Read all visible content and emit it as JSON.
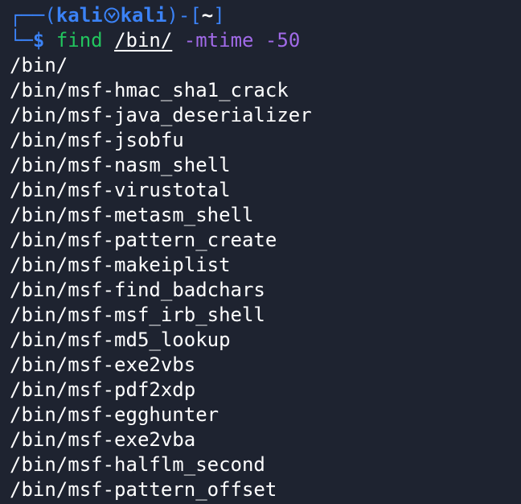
{
  "prompt": {
    "open_bracket": "┌──(",
    "user": "kali",
    "host": "kali",
    "close_mid": ")-[",
    "cwd": "~",
    "close_bracket": "]",
    "lower_bracket": "└─",
    "dollar": "$",
    "command": "find",
    "argument": "/bin/",
    "option": "-mtime",
    "value": "-50"
  },
  "output_lines": [
    "/bin/",
    "/bin/msf-hmac_sha1_crack",
    "/bin/msf-java_deserializer",
    "/bin/msf-jsobfu",
    "/bin/msf-nasm_shell",
    "/bin/msf-virustotal",
    "/bin/msf-metasm_shell",
    "/bin/msf-pattern_create",
    "/bin/msf-makeiplist",
    "/bin/msf-find_badchars",
    "/bin/msf-msf_irb_shell",
    "/bin/msf-md5_lookup",
    "/bin/msf-exe2vbs",
    "/bin/msf-pdf2xdp",
    "/bin/msf-egghunter",
    "/bin/msf-exe2vba",
    "/bin/msf-halflm_second",
    "/bin/msf-pattern_offset"
  ],
  "colors": {
    "background": "#1e2330",
    "prompt_frame": "#3b82f6",
    "command": "#22c55e",
    "option": "#a16ae8",
    "text": "#ffffff"
  }
}
